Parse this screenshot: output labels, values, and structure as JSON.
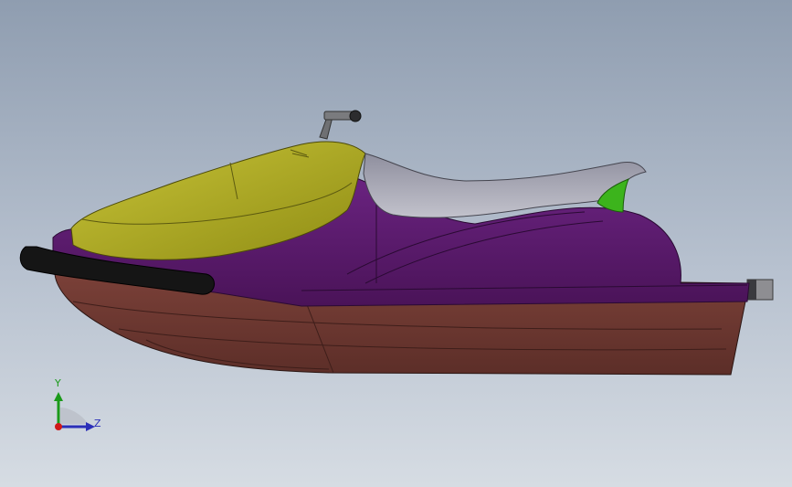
{
  "scene": {
    "model_name": "jet-ski",
    "colors": {
      "background_top": "#8f9db0",
      "background_bottom": "#d6dce3",
      "hull": "#6e3a33",
      "body": "#5a1a6a",
      "front_cover": "#b9b528",
      "seat": "#a9a9b5",
      "bumper": "#151515",
      "accent_green": "#3cb41c",
      "handlebar": "#6f7073"
    }
  },
  "triad": {
    "y_label": "Y",
    "z_label": "Z",
    "y_color": "#1a9a1a",
    "z_color": "#2b2fb8",
    "origin_color": "#d01818"
  }
}
